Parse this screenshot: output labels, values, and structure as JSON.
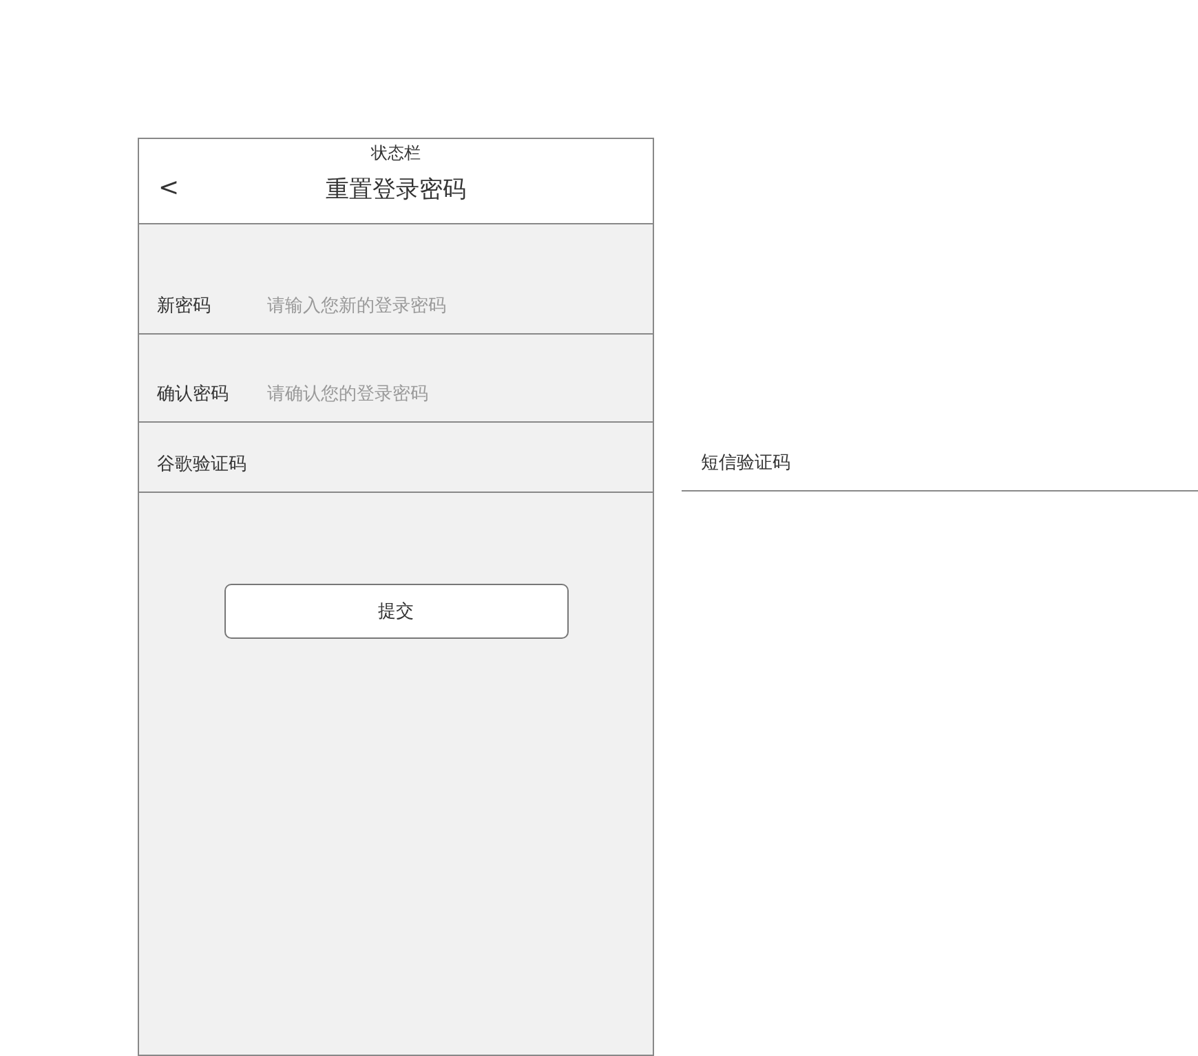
{
  "status_bar": "状态栏",
  "header": {
    "back": "<",
    "title": "重置登录密码"
  },
  "fields": [
    {
      "label": "新密码",
      "placeholder": "请输入您新的登录密码"
    },
    {
      "label": "确认密码",
      "placeholder": "请确认您的登录密码"
    }
  ],
  "code_row": {
    "label": "谷歌验证码"
  },
  "submit_button": "提交",
  "side_code_row": {
    "label": "短信验证码"
  }
}
